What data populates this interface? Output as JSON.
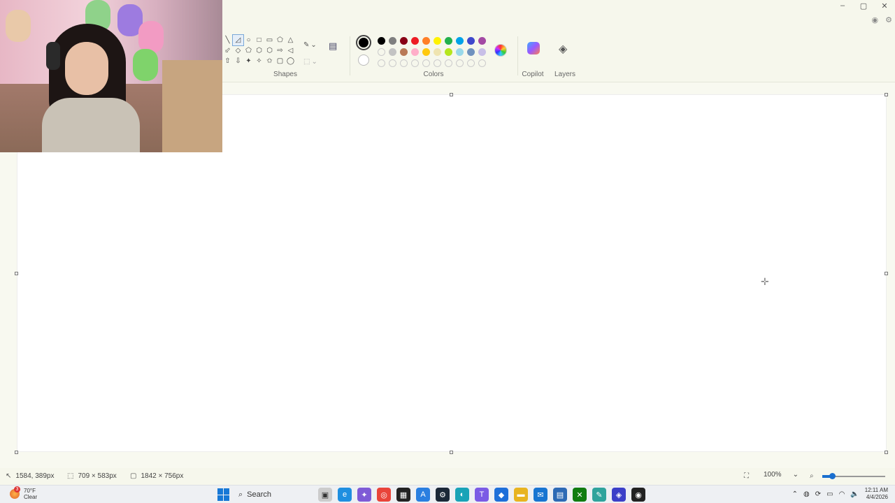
{
  "window": {
    "controls": [
      "–",
      "▢",
      "✕"
    ]
  },
  "ribbon": {
    "shapes_label": "Shapes",
    "colors_label": "Colors",
    "copilot_label": "Copilot",
    "layers_label": "Layers",
    "shape_symbols": [
      "╲",
      "◿",
      "○",
      "□",
      "▭",
      "⬠",
      "△",
      "⬃",
      "◇",
      "⬠",
      "⬡",
      "⬡",
      "⇨",
      "◁",
      "⇧",
      "⇩",
      "✦",
      "✧",
      "✩",
      "▢",
      "◯"
    ],
    "palette_row1": [
      "#000000",
      "#7f7f7f",
      "#880015",
      "#ed1c24",
      "#ff7f27",
      "#fff200",
      "#22b14c",
      "#00a2e8",
      "#3f48cc",
      "#a349a4"
    ],
    "palette_row2": [
      "empty",
      "#c3c3c3",
      "#b97a57",
      "#ffaec9",
      "#ffc90e",
      "#efe4b0",
      "#b5e61d",
      "#99d9ea",
      "#7092be",
      "#c8bfe7"
    ],
    "palette_row3": [
      "empty",
      "empty",
      "empty",
      "empty",
      "empty",
      "empty",
      "empty",
      "empty",
      "empty",
      "empty"
    ],
    "primary_color": "#000000",
    "secondary_color": "#ffffff"
  },
  "status": {
    "cursor_position": "1584, 389px",
    "selection_size": "709 × 583px",
    "canvas_size": "1842 × 756px",
    "zoom_level": "100%",
    "zoom_percent": 15
  },
  "taskbar": {
    "weather_temp": "70°F",
    "weather_cond": "Clear",
    "weather_badge": "3",
    "search_label": "Search",
    "time": "12:11 AM",
    "date": "4/4/2026"
  }
}
